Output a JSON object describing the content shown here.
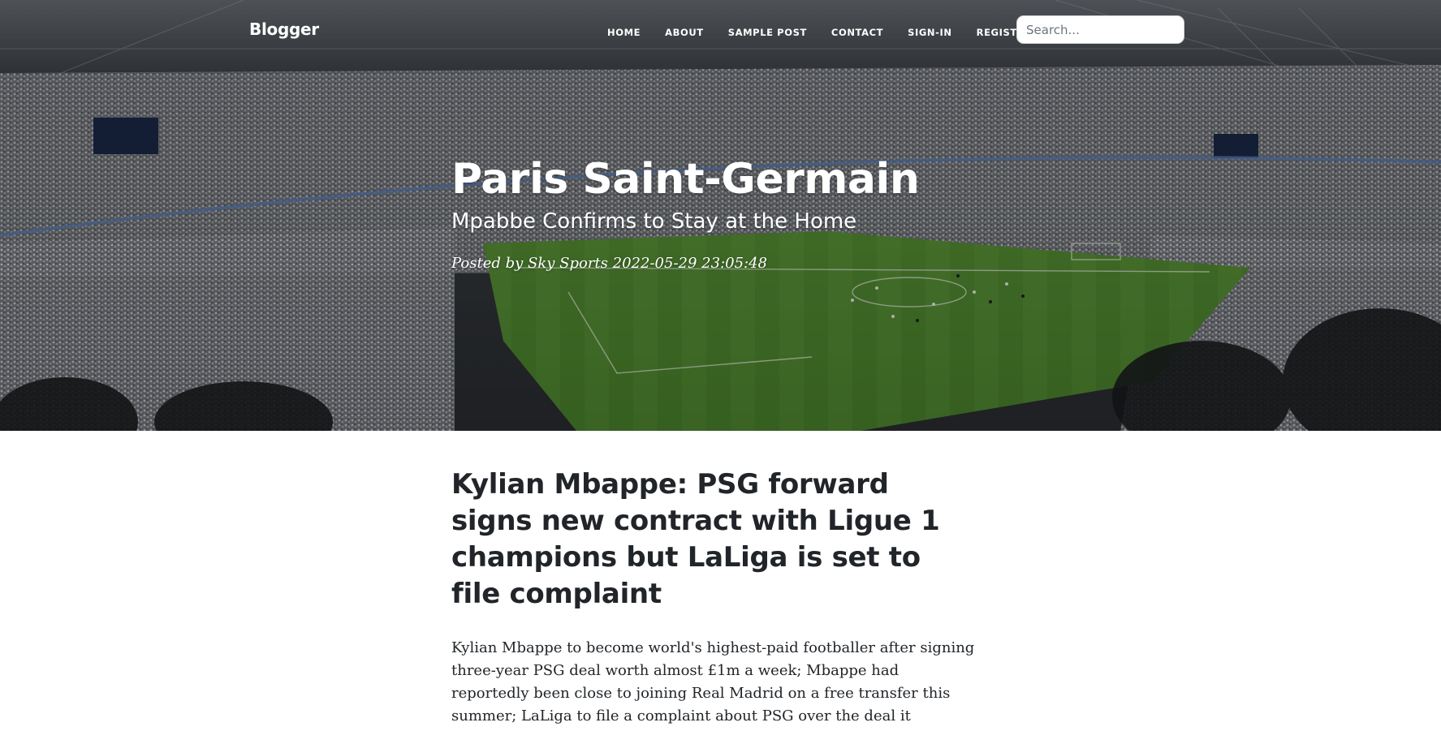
{
  "nav": {
    "brand": "Blogger",
    "links": [
      {
        "label": "HOME"
      },
      {
        "label": "ABOUT"
      },
      {
        "label": "SAMPLE POST"
      },
      {
        "label": "CONTACT"
      },
      {
        "label": "SIGN-IN"
      },
      {
        "label": "REGISTER"
      }
    ],
    "search": {
      "placeholder": "Search...",
      "value": ""
    }
  },
  "hero": {
    "title": "Paris Saint-Germain",
    "subtitle": "Mpabbe Confirms to Stay at the Home",
    "meta": {
      "posted_by_label": "Posted by",
      "author": "Sky Sports",
      "timestamp": "2022-05-29 23:05:48"
    }
  },
  "article": {
    "title": "Kylian Mbappe: PSG forward signs new contract with Ligue 1 champions but LaLiga is set to file complaint",
    "lead": "Kylian Mbappe to become world's highest-paid footballer after signing three-year PSG deal worth almost £1m a week; Mbappe had reportedly been close to joining Real Madrid on a free transfer this summer; LaLiga to file a complaint about PSG over the deal it describes as 'scandalous'"
  },
  "colors": {
    "text": "#212529",
    "pitch": "#4f8a2e",
    "nav_text": "#ffffff"
  }
}
